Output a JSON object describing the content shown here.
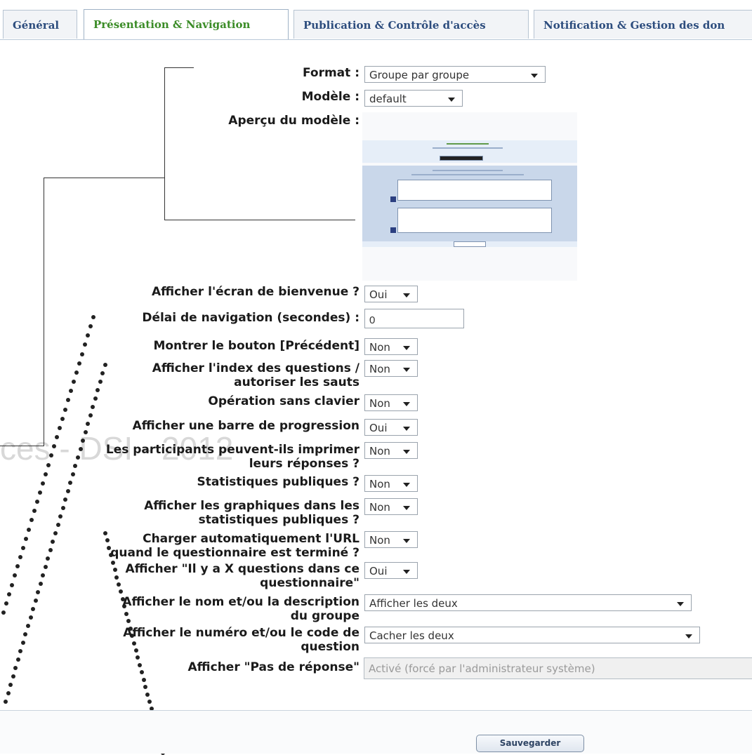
{
  "tabs": [
    {
      "label": "Général"
    },
    {
      "label": "Présentation & Navigation"
    },
    {
      "label": "Publication & Contrôle d'accès"
    },
    {
      "label": "Notification & Gestion des don"
    }
  ],
  "form": {
    "format_label": "Format :",
    "format_value": "Groupe par groupe",
    "model_label": "Modèle :",
    "model_value": "default",
    "preview_label": "Aperçu du modèle :",
    "welcome_label": "Afficher l'écran de bienvenue ?",
    "welcome_value": "Oui",
    "delay_label": "Délai de navigation (secondes) :",
    "delay_value": "0",
    "prev_label": "Montrer le bouton [Précédent]",
    "prev_value": "Non",
    "index_label_1": "Afficher l'index des questions /",
    "index_label_2": "autoriser les sauts",
    "index_value": "Non",
    "keyboard_label": "Opération sans clavier",
    "keyboard_value": "Non",
    "progress_label": "Afficher une barre de progression",
    "progress_value": "Oui",
    "print_label_1": "Les participants peuvent-ils imprimer",
    "print_label_2": "leurs réponses ?",
    "print_value": "Non",
    "stats_label": "Statistiques publiques ?",
    "stats_value": "Non",
    "graphs_label_1": "Afficher les graphiques dans les",
    "graphs_label_2": "statistiques publiques ?",
    "graphs_value": "Non",
    "url_label_1": "Charger automatiquement l'URL",
    "url_label_2": "quand le questionnaire est terminé ?",
    "url_value": "Non",
    "xq_label_1": "Afficher \"Il y a X questions dans ce",
    "xq_label_2": "questionnaire\"",
    "xq_value": "Oui",
    "groupname_label_1": "Afficher le nom et/ou la description",
    "groupname_label_2": "du groupe",
    "groupname_value": "Afficher les deux",
    "qcode_label_1": "Afficher le numéro et/ou le code de",
    "qcode_label_2": "question",
    "qcode_value": "Cacher les deux",
    "noanswer_label": "Afficher \"Pas de réponse\"",
    "noanswer_value": "Activé (forcé par l'administrateur système)"
  },
  "save_label": "Sauvegarder",
  "watermark": "ces - DSI - 2012",
  "colors": {
    "active_tab": "#3b8c27",
    "tab_text": "#2d4d7e"
  }
}
